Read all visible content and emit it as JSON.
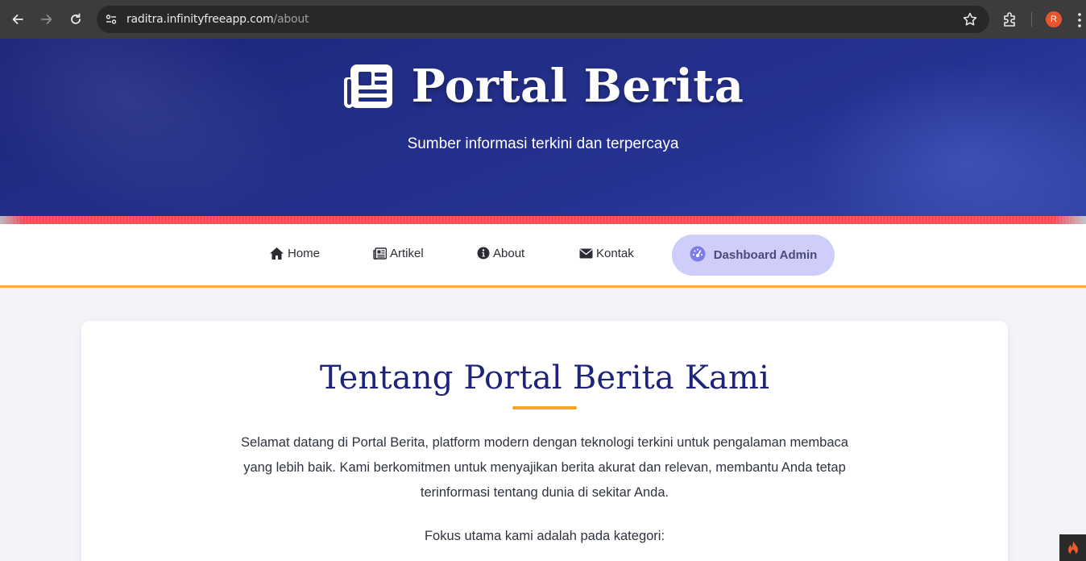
{
  "browser": {
    "url_host": "raditra.infinityfreeapp.com",
    "url_path": "/about",
    "profile_initial": "R",
    "icons": [
      "back-icon",
      "forward-icon",
      "reload-icon",
      "site-settings-icon",
      "star-icon",
      "extensions-icon",
      "menu-icon"
    ]
  },
  "hero": {
    "title": "Portal Berita",
    "subtitle": "Sumber informasi terkini dan terpercaya",
    "icon": "newspaper-icon"
  },
  "nav": {
    "items": [
      {
        "label": "Home",
        "icon": "home-icon"
      },
      {
        "label": "Artikel",
        "icon": "newspaper-icon"
      },
      {
        "label": "About",
        "icon": "info-icon"
      },
      {
        "label": "Kontak",
        "icon": "envelope-icon"
      }
    ],
    "dashboard": {
      "label": "Dashboard Admin",
      "icon": "gauge-icon"
    }
  },
  "about": {
    "heading": "Tentang Portal Berita Kami",
    "paragraph_line1": "Selamat datang di Portal Berita, platform modern dengan teknologi terkini untuk pengalaman membaca",
    "paragraph_line2": "yang lebih baik. Kami berkomitmen untuk menyajikan berita akurat dan relevan, membantu Anda tetap",
    "paragraph_line3": "terinformasi tentang dunia di sekitar Anda.",
    "focus_text": "Fokus utama kami adalah pada kategori:"
  },
  "colors": {
    "hero_bg": "#222d85",
    "accent_orange": "#f5a623",
    "stripe_red": "#ef4d57",
    "heading_navy": "#1d2479",
    "dashboard_btn": "#cfcdfa"
  }
}
